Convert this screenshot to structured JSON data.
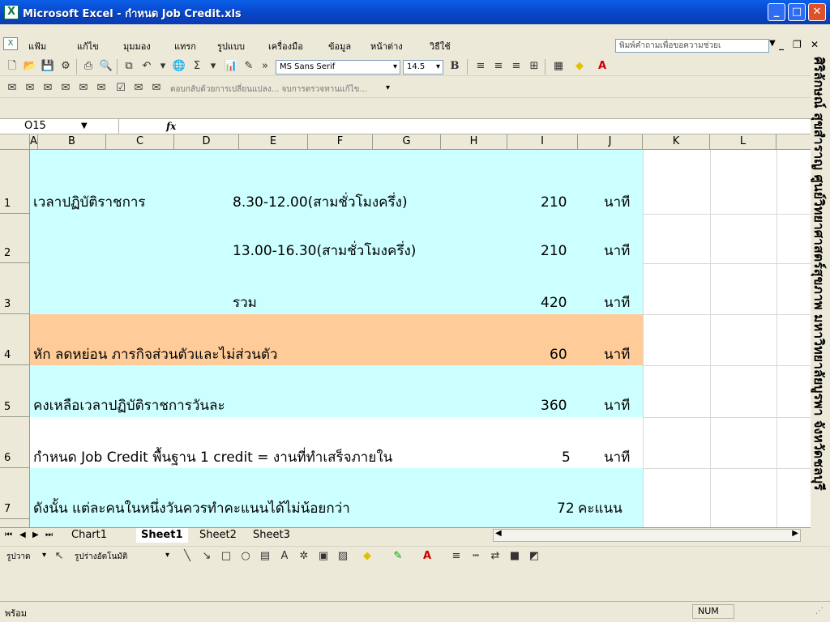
{
  "window": {
    "title": "Microsoft Excel - กำหนด Job Credit.xls"
  },
  "menu": [
    "แฟ้ม",
    "แก้ไข",
    "มุมมอง",
    "แทรก",
    "รูปแบบ",
    "เครื่องมือ",
    "ข้อมูล",
    "หน้าต่าง",
    "วิธีใช้"
  ],
  "help_placeholder": "พิมพ์คำถามเพื่อขอความช่วยเ",
  "toolbar": {
    "font": "MS Sans Serif",
    "size": "14.5",
    "bold": "B"
  },
  "review_toolbar": "ตอบกลับด้วยการเปลี่ยนแปลง... จบการตรวจทานแก้ไข...",
  "name_box": "O15",
  "fx_label": "fx",
  "columns": [
    "A",
    "B",
    "C",
    "D",
    "E",
    "F",
    "G",
    "H",
    "I",
    "J",
    "K",
    "L"
  ],
  "rows": [
    {
      "num": "1",
      "a": "เวลาปฏิบัติราชการ",
      "e": "8.30-12.00(สามชั่วโมงครึ่ง)",
      "i": "210",
      "j": "นาที"
    },
    {
      "num": "2",
      "a": "",
      "e": "13.00-16.30(สามชั่วโมงครึ่ง)",
      "i": "210",
      "j": "นาที"
    },
    {
      "num": "3",
      "a": "",
      "e": "รวม",
      "i": "420",
      "j": "นาที"
    },
    {
      "num": "4",
      "a": "หัก ลดหย่อน ภารกิจส่วนตัวและไม่ส่วนตัว",
      "e": "",
      "i": "60",
      "j": "นาที"
    },
    {
      "num": "5",
      "a": " คงเหลือเวลาปฏิบัติราชการวันละ",
      "e": "",
      "i": "360",
      "j": "นาที"
    },
    {
      "num": "6",
      "a": "กำหนด Job Credit  พื้นฐาน 1 credit = งานที่ทำเสร็จภายใน",
      "e": "",
      "i": "5",
      "j": "นาที"
    },
    {
      "num": "7",
      "a": "ดังนั้น แต่ละคนในหนึ่งวันควรทำคะแนนได้ไม่น้อยกว่า",
      "e": "",
      "i": "72",
      "j": "คะแนน"
    }
  ],
  "vertical_text": "ศิริลักษณ์ สุขสำราญ ศูนย์วิทยาศาสตร์สุขภาพ มหาวิทยาลัยบูรพา จังหวัดชลบุรี",
  "sheets": [
    "Chart1",
    "Sheet1",
    "Sheet2",
    "Sheet3"
  ],
  "active_sheet": "Sheet1",
  "draw": {
    "draw_label": "รูปวาด",
    "autoshapes_label": "รูปร่างอัตโนมัติ"
  },
  "status": {
    "ready": "พร้อม",
    "num": "NUM"
  },
  "colors": {
    "cyan": "#ccffff",
    "orange": "#ffcc99",
    "white": "#ffffff"
  }
}
